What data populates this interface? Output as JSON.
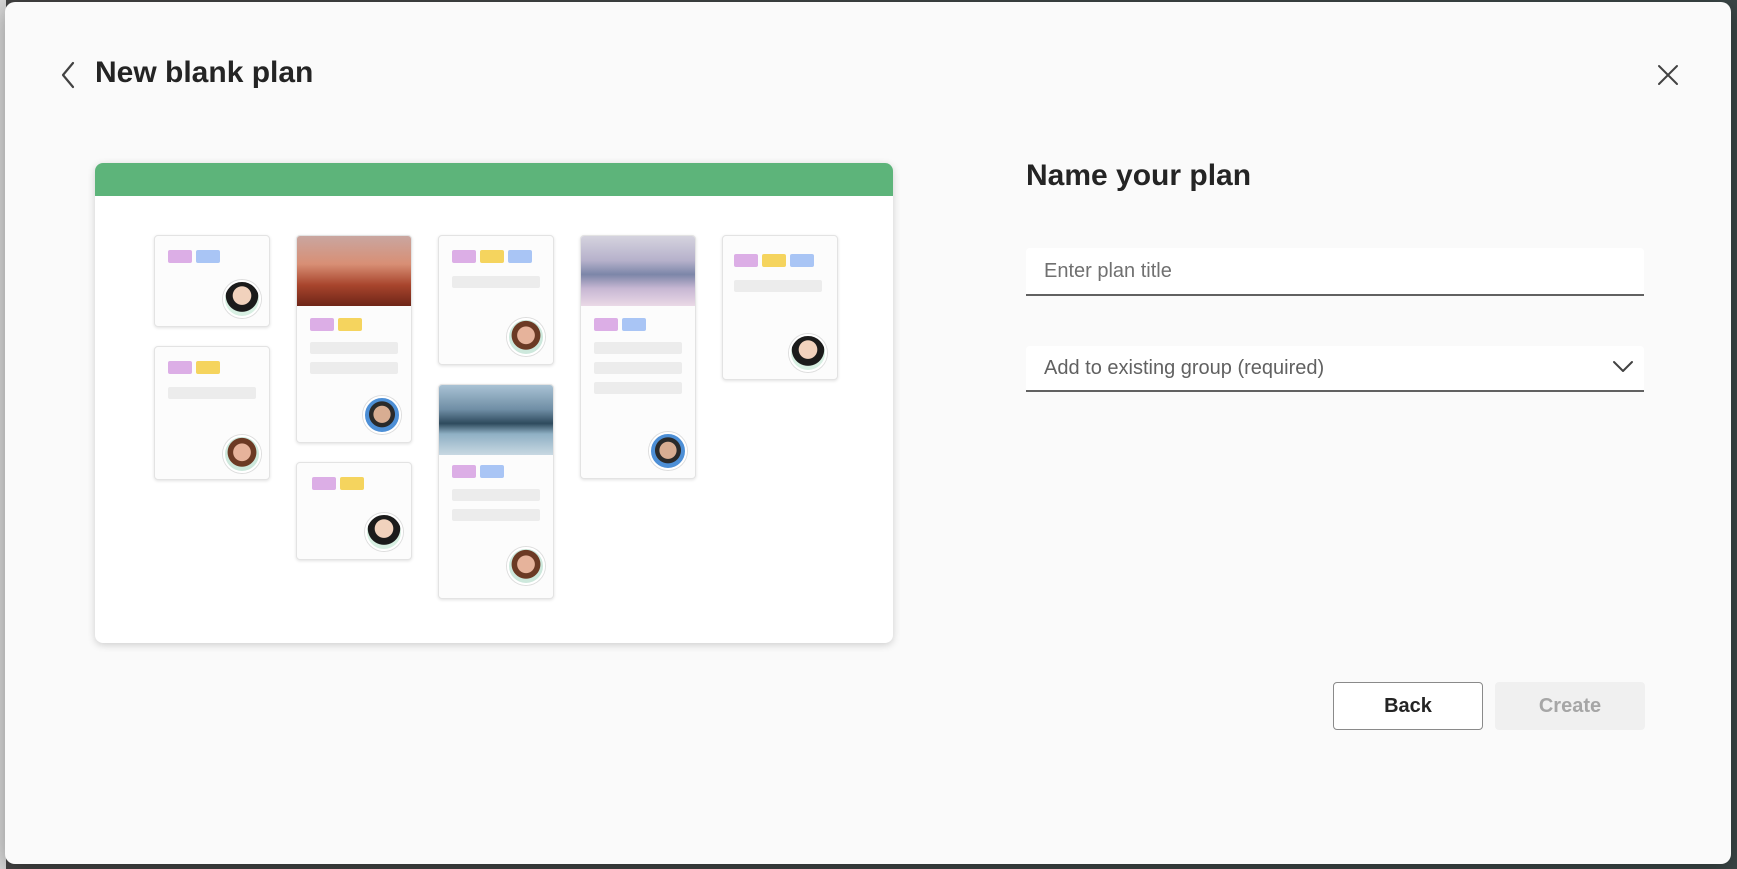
{
  "dialog": {
    "title": "New blank plan",
    "form_title": "Name your plan",
    "plan_title_placeholder": "Enter plan title",
    "plan_title_value": "",
    "group_select_text": "Add to existing group (required)",
    "back_label": "Back",
    "create_label": "Create",
    "create_enabled": false
  },
  "colors": {
    "header_bar": "#5db47a",
    "tag_pink": "#dcaee6",
    "tag_blue": "#a9c5f5",
    "tag_yellow": "#f5d45e"
  },
  "icons": {
    "back": "chevron-left-icon",
    "close": "close-icon",
    "dropdown": "chevron-down-icon"
  }
}
